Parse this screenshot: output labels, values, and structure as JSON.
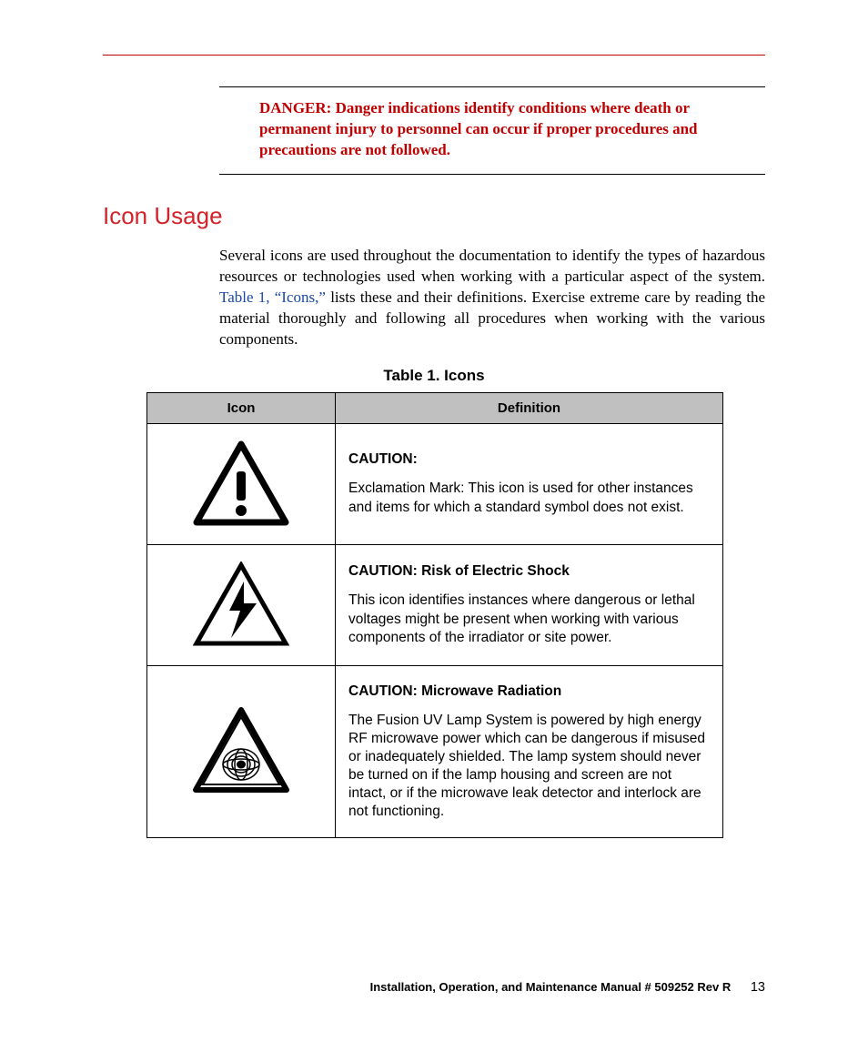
{
  "danger_text": "DANGER: Danger indications identify conditions where death or permanent injury to personnel can occur if proper procedures and precautions are not followed.",
  "section_heading": "Icon Usage",
  "body_para_pre": "Several icons are used throughout the documentation to identify the types of hazardous resources or technologies used when working with a particular aspect of the system. ",
  "body_para_xref": "Table 1, “Icons,”",
  "body_para_post": " lists these and their definitions. Exercise extreme care by reading the material thoroughly and following all procedures when working with the various components.",
  "table_caption": "Table 1. Icons",
  "table_headers": {
    "icon": "Icon",
    "definition": "Definition"
  },
  "rows": [
    {
      "title": "CAUTION:",
      "text": "Exclamation Mark: This icon is used for other instances and items for which a standard symbol does not exist."
    },
    {
      "title": "CAUTION: Risk of Electric Shock",
      "text": "This icon identifies instances where dangerous or lethal voltages might be present when working with various components of the irradiator or site power."
    },
    {
      "title": "CAUTION: Microwave Radiation",
      "text": "The Fusion UV Lamp System is powered by high energy RF microwave power which can be dangerous if misused or inadequately shielded. The lamp system should never be turned on if the lamp housing and screen are not intact, or if the microwave leak detector and interlock are not functioning."
    }
  ],
  "footer_title": "Installation, Operation, and Maintenance Manual  # 509252 Rev R",
  "page_number": "13"
}
